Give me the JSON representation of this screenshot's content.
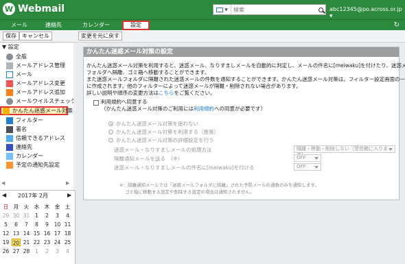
{
  "app": {
    "logo_letter": "W",
    "name": "Webmail"
  },
  "search": {
    "placeholder": "検索"
  },
  "user": {
    "email": "abc12345@po.across.or.jp"
  },
  "nav": {
    "tabs": [
      "メール",
      "連絡先",
      "カレンダー",
      "設定"
    ],
    "active": "設定"
  },
  "toolbar": {
    "save": "保存",
    "cancel": "キャンセル",
    "revert": "変更を元に戻す"
  },
  "sidebar": {
    "header": "設定",
    "items": [
      {
        "label": "全般",
        "icon": "gear-icon"
      },
      {
        "label": "メールアドレス管理",
        "icon": "address-manage-icon"
      },
      {
        "label": "メール",
        "icon": "mail-icon"
      },
      {
        "label": "メールアドレス変更",
        "icon": "address-change-icon"
      },
      {
        "label": "メールアドレス追加",
        "icon": "address-add-icon"
      },
      {
        "label": "メールウイルスチェック",
        "icon": "virus-check-icon"
      },
      {
        "label": "かんたん迷惑メール対策",
        "icon": "spam-filter-icon"
      },
      {
        "label": "フィルター",
        "icon": "filter-icon"
      },
      {
        "label": "署名",
        "icon": "signature-icon"
      },
      {
        "label": "信頼できるアドレス",
        "icon": "trusted-address-icon"
      },
      {
        "label": "連絡先",
        "icon": "contacts-icon"
      },
      {
        "label": "カレンダー",
        "icon": "calendar-icon"
      },
      {
        "label": "予定の通知先設定",
        "icon": "notification-icon"
      }
    ]
  },
  "calendar": {
    "title": "2017年 2月",
    "weekdays": [
      "日",
      "月",
      "火",
      "水",
      "木",
      "金",
      "土"
    ],
    "weeks": [
      [
        "29",
        "30",
        "31",
        "1",
        "2",
        "3",
        "4"
      ],
      [
        "5",
        "6",
        "7",
        "8",
        "9",
        "10",
        "11"
      ],
      [
        "12",
        "13",
        "14",
        "15",
        "16",
        "17",
        "18"
      ],
      [
        "19",
        "20",
        "21",
        "22",
        "23",
        "24",
        "25"
      ],
      [
        "26",
        "27",
        "28",
        "1",
        "2",
        "3",
        "4"
      ]
    ],
    "today": "20"
  },
  "panel": {
    "title": "かんたん迷惑メール対策の設定",
    "desc": [
      "かんたん迷惑メール対策を利用すると、迷惑メール、なりすましメールを自動的に判定し、メールの件名に[meiwaku]を付けたり、迷惑メール",
      "フォルダへ隔離、ゴミ箱へ移動することができます。",
      "また迷惑メールフォルダに隔離された迷惑メールの件数を通知することができます。かんたん迷惑メール対策は、フィルター設定画面の一番下",
      "に作成されます。他のフィルターによって迷惑メールが隔離・削除されない場合があります。"
    ],
    "detail_prefix": "詳しい説明や順序の変更方法は",
    "detail_link": "こちら",
    "detail_suffix": "をご覧ください。",
    "agree_label": "利用規約へ同意する",
    "agree_sub_prefix": "（かんたん迷惑メール対策のご利用には",
    "agree_sub_link": "利用規約",
    "agree_sub_suffix": "への同意が必要です）",
    "radio_options": [
      "かんたん迷惑メール対策を使わない",
      "かんたん迷惑メール対策を利用する（推奨）",
      "かんたん迷惑メール対策の詳細設定を行う"
    ],
    "settings": [
      {
        "label": "迷惑メール・なりすましメールの処理方法",
        "value": "隔離・移動・削除しない（受信箱に入ります）"
      },
      {
        "label": "隔離通知メールを送る　（※）",
        "value": "OFF"
      },
      {
        "label": "迷惑メール・なりすましメールの件名に[meiwaku]を付ける",
        "value": "OFF"
      }
    ],
    "note1": "※：隔離通知メールでは「迷惑メールフォルダに隔離」された予防メールの通数のみを通知します。",
    "note2": "ゴミ箱に移動する設定や削除する設定の場合は通知されません。"
  },
  "colors": {
    "brand": "#2b8a3e",
    "highlight": "#e03131",
    "link": "#1c7ed6"
  }
}
